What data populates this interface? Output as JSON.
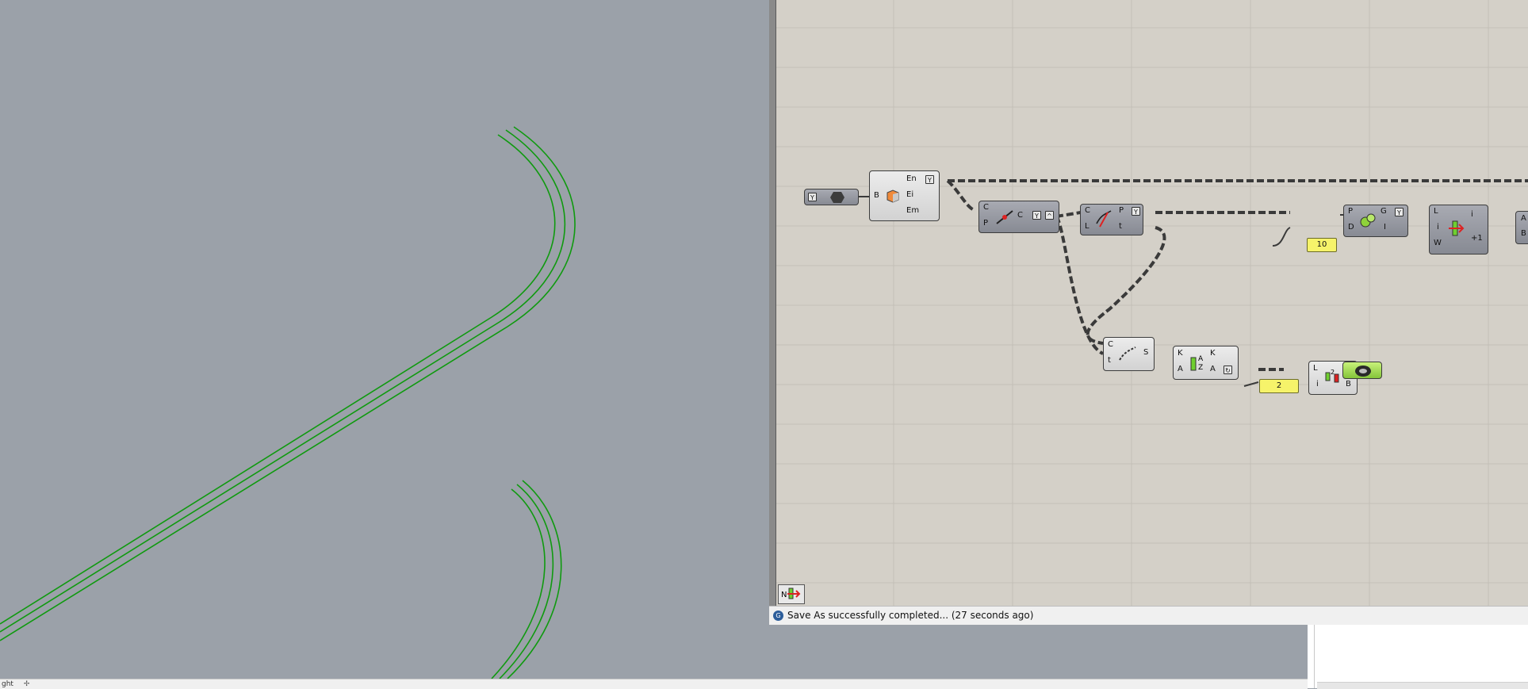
{
  "status_bar": {
    "message": "Save As successfully completed... (27 seconds ago)"
  },
  "rhino_status": {
    "left_text": "ght"
  },
  "components": {
    "boolean_toggle_label": "",
    "brep_edges": {
      "input": "B",
      "outputs": [
        "En",
        "Ei",
        "Em"
      ]
    },
    "curve_closest": {
      "inputs": [
        "C",
        "P"
      ],
      "output": "C"
    },
    "evaluate": {
      "inputs": [
        "C",
        "L"
      ],
      "outputs": [
        "P",
        "t"
      ]
    },
    "shatter": {
      "inputs": [
        "C",
        "t"
      ],
      "output": "S"
    },
    "sort_list": {
      "inputs": [
        "K",
        "A"
      ],
      "outputs": [
        "K",
        "A"
      ]
    },
    "split_list": {
      "inputs": [
        "L",
        "i"
      ],
      "outputs": [
        "A",
        "B"
      ]
    },
    "divide": {
      "inputs": [
        "P",
        "D"
      ],
      "outputs": [
        "G",
        "I"
      ]
    },
    "list_item": {
      "inputs": [
        "L",
        "i",
        "W"
      ],
      "outputs": [
        "i",
        "+1"
      ]
    },
    "partial": {
      "outputs": [
        "A",
        "B"
      ]
    }
  },
  "sliders": {
    "divide_count": "10",
    "split_index": "2"
  },
  "colors": {
    "curve_green": "#0f9a0f",
    "canvas_bg": "#d4d0c8",
    "viewport_bg": "#9ba1a9"
  }
}
